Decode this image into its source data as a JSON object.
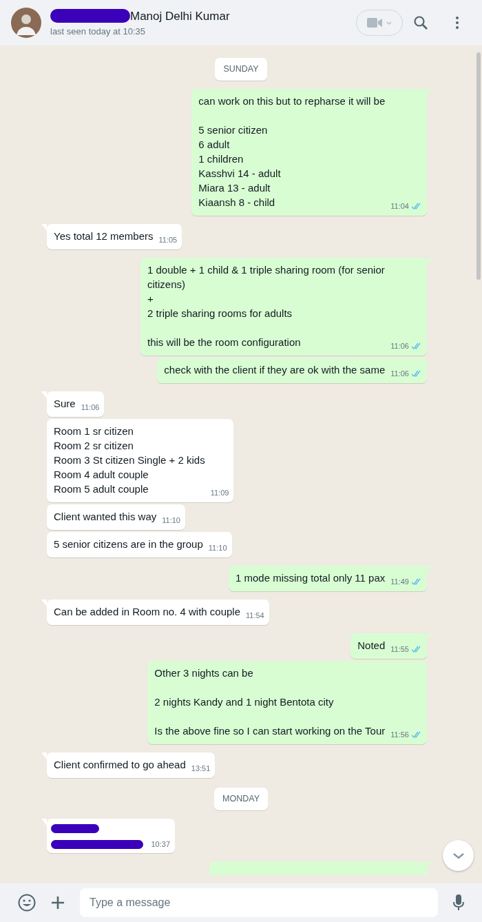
{
  "header": {
    "name": "Manoj Delhi Kumar",
    "name_redacted": true,
    "status": "last seen today at 10:35"
  },
  "messages": [
    {
      "kind": "date",
      "text": "SUNDAY"
    },
    {
      "kind": "text",
      "outgoing": true,
      "tail": true,
      "text": "can work on this but to repharse it will be\n\n5 senior citizen\n6 adult\n1 children\nKasshvi 14 - adult\nMiara 13 - adult\nKiaansh 8 - child",
      "time": "11:04",
      "read": true
    },
    {
      "kind": "text",
      "outgoing": false,
      "tail": true,
      "text": "Yes total 12 members",
      "time": "11:05"
    },
    {
      "kind": "text",
      "outgoing": true,
      "tail": true,
      "text": "1 double + 1 child & 1 triple sharing room (for senior citizens)\n+\n2 triple sharing rooms for adults\n\nthis will be the room configuration",
      "time": "11:06",
      "read": true
    },
    {
      "kind": "text",
      "outgoing": true,
      "tail": false,
      "text": "check with the client if they are ok with the same",
      "time": "11:06",
      "read": true
    },
    {
      "kind": "text",
      "outgoing": false,
      "tail": true,
      "text": "Sure",
      "time": "11:06"
    },
    {
      "kind": "text",
      "outgoing": false,
      "tail": false,
      "text": "Room 1 sr citizen\nRoom 2 sr citizen\nRoom 3 St citizen Single + 2 kids\nRoom 4 adult couple\nRoom 5 adult couple",
      "time": "11:09"
    },
    {
      "kind": "text",
      "outgoing": false,
      "tail": false,
      "text": "Client wanted this way",
      "time": "11:10"
    },
    {
      "kind": "text",
      "outgoing": false,
      "tail": false,
      "text": "5 senior citizens are in the group",
      "time": "11:10"
    },
    {
      "kind": "text",
      "outgoing": true,
      "tail": true,
      "text": "1 mode missing total only 11 pax",
      "time": "11:49",
      "read": true
    },
    {
      "kind": "text",
      "outgoing": false,
      "tail": true,
      "text": "Can be added in Room no. 4 with couple",
      "time": "11:54"
    },
    {
      "kind": "text",
      "outgoing": true,
      "tail": true,
      "text": "Noted",
      "time": "11:55",
      "read": true
    },
    {
      "kind": "text",
      "outgoing": true,
      "tail": false,
      "text": "Other 3 nights can be\n\n2 nights Kandy and 1 night Bentota city\n\nIs the above fine so I can start working on the Tour",
      "time": "11:56",
      "read": true
    },
    {
      "kind": "text",
      "outgoing": false,
      "tail": true,
      "text": "Client confirmed to go ahead",
      "time": "13:51"
    },
    {
      "kind": "date",
      "text": "MONDAY"
    },
    {
      "kind": "redacted",
      "outgoing": false,
      "tail": true,
      "time": "10:37"
    },
    {
      "kind": "cut_off",
      "outgoing": true,
      "tail": true
    }
  ],
  "composer": {
    "placeholder": "Type a message"
  }
}
